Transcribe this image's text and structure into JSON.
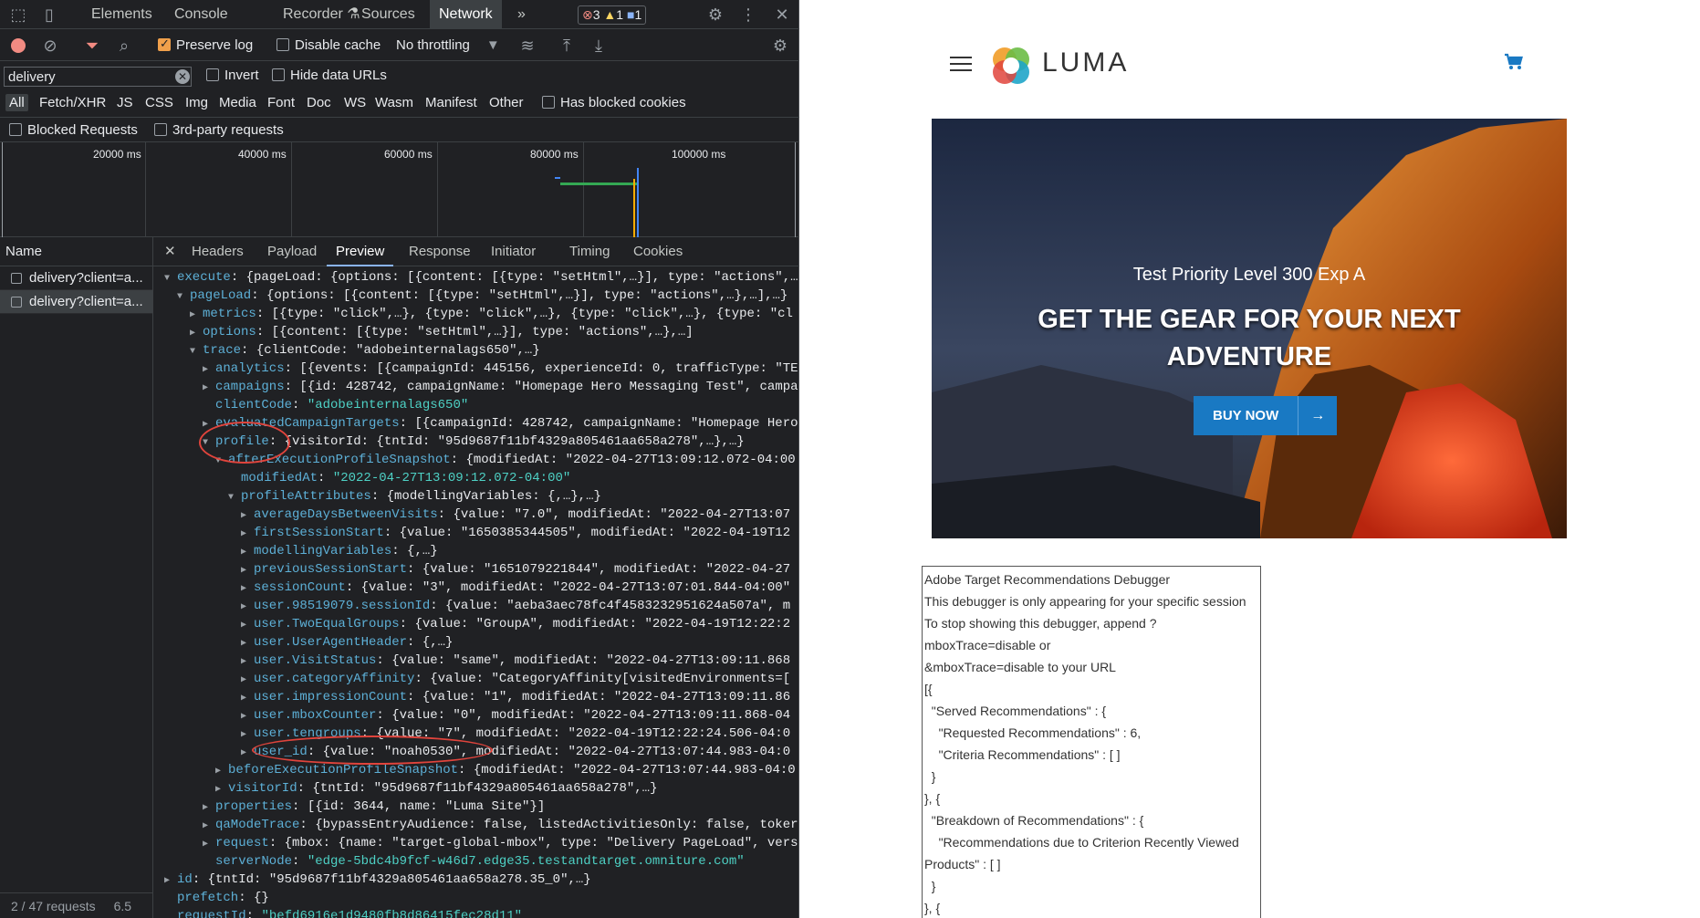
{
  "devtools": {
    "tabs": [
      "Elements",
      "Console",
      "Recorder",
      "Sources",
      "Network"
    ],
    "active_tab": "Network",
    "more": "»",
    "badges": {
      "errors": "3",
      "warnings": "1",
      "issues": "1"
    },
    "toolbar": {
      "preserve_log": "Preserve log",
      "disable_cache": "Disable cache",
      "throttling": "No throttling"
    },
    "filter": {
      "value": "delivery",
      "invert": "Invert",
      "hide_data_urls": "Hide data URLs"
    },
    "types": [
      "All",
      "Fetch/XHR",
      "JS",
      "CSS",
      "Img",
      "Media",
      "Font",
      "Doc",
      "WS",
      "Wasm",
      "Manifest",
      "Other"
    ],
    "has_blocked_cookies": "Has blocked cookies",
    "blocked_requests": "Blocked Requests",
    "third_party": "3rd-party requests",
    "timeline_ticks": [
      "20000 ms",
      "40000 ms",
      "60000 ms",
      "80000 ms",
      "100000 ms"
    ],
    "name_header": "Name",
    "requests": [
      "delivery?client=a...",
      "delivery?client=a..."
    ],
    "status": "2 / 47 requests",
    "status_size": "6.5",
    "detail_tabs": [
      "Headers",
      "Payload",
      "Preview",
      "Response",
      "Initiator",
      "Timing",
      "Cookies"
    ],
    "active_detail_tab": "Preview",
    "preview_lines": [
      {
        "indent": 1,
        "tri": "▼",
        "key": "execute",
        "rest": ": {pageLoad: {options: [{content: [{type: \"setHtml\",…}], type: \"actions\",…"
      },
      {
        "indent": 2,
        "tri": "▼",
        "key": "pageLoad",
        "rest": ": {options: [{content: [{type: \"setHtml\",…}], type: \"actions\",…},…],…}"
      },
      {
        "indent": 3,
        "tri": "▶",
        "key": "metrics",
        "rest": ": [{type: \"click\",…}, {type: \"click\",…}, {type: \"click\",…}, {type: \"cl"
      },
      {
        "indent": 3,
        "tri": "▶",
        "key": "options",
        "rest": ": [{content: [{type: \"setHtml\",…}], type: \"actions\",…},…]"
      },
      {
        "indent": 3,
        "tri": "▼",
        "key": "trace",
        "rest": ": {clientCode: \"adobeinternalags650\",…}"
      },
      {
        "indent": 4,
        "tri": "▶",
        "key": "analytics",
        "rest": ": [{events: [{campaignId: 445156, experienceId: 0, trafficType: \"TE"
      },
      {
        "indent": 4,
        "tri": "▶",
        "key": "campaigns",
        "rest": ": [{id: 428742, campaignName: \"Homepage Hero Messaging Test\", campa"
      },
      {
        "indent": 4,
        "tri": "",
        "key": "clientCode",
        "rest": ": ",
        "str": "\"adobeinternalags650\""
      },
      {
        "indent": 4,
        "tri": "▶",
        "key": "evaluatedCampaignTargets",
        "rest": ": [{campaignId: 428742, campaignName: \"Homepage Hero"
      },
      {
        "indent": 4,
        "tri": "▼",
        "key": "profile",
        "rest": ": {visitorId: {tntId: \"95d9687f11bf4329a805461aa658a278\",…},…}"
      },
      {
        "indent": 5,
        "tri": "▼",
        "key": "afterExecutionProfileSnapshot",
        "rest": ": {modifiedAt: \"2022-04-27T13:09:12.072-04:00"
      },
      {
        "indent": 6,
        "tri": "",
        "key": "modifiedAt",
        "rest": ": ",
        "str": "\"2022-04-27T13:09:12.072-04:00\""
      },
      {
        "indent": 6,
        "tri": "▼",
        "key": "profileAttributes",
        "rest": ": {modellingVariables: {,…},…}"
      },
      {
        "indent": 7,
        "tri": "▶",
        "key": "averageDaysBetweenVisits",
        "rest": ": {value: \"7.0\", modifiedAt: \"2022-04-27T13:07"
      },
      {
        "indent": 7,
        "tri": "▶",
        "key": "firstSessionStart",
        "rest": ": {value: \"1650385344505\", modifiedAt: \"2022-04-19T12"
      },
      {
        "indent": 7,
        "tri": "▶",
        "key": "modellingVariables",
        "rest": ": {,…}"
      },
      {
        "indent": 7,
        "tri": "▶",
        "key": "previousSessionStart",
        "rest": ": {value: \"1651079221844\", modifiedAt: \"2022-04-27"
      },
      {
        "indent": 7,
        "tri": "▶",
        "key": "sessionCount",
        "rest": ": {value: \"3\", modifiedAt: \"2022-04-27T13:07:01.844-04:00\""
      },
      {
        "indent": 7,
        "tri": "▶",
        "key": "user.98519079.sessionId",
        "rest": ": {value: \"aeba3aec78fc4f4583232951624a507a\", m"
      },
      {
        "indent": 7,
        "tri": "▶",
        "key": "user.TwoEqualGroups",
        "rest": ": {value: \"GroupA\", modifiedAt: \"2022-04-19T12:22:2"
      },
      {
        "indent": 7,
        "tri": "▶",
        "key": "user.UserAgentHeader",
        "rest": ": {,…}"
      },
      {
        "indent": 7,
        "tri": "▶",
        "key": "user.VisitStatus",
        "rest": ": {value: \"same\", modifiedAt: \"2022-04-27T13:09:11.868"
      },
      {
        "indent": 7,
        "tri": "▶",
        "key": "user.categoryAffinity",
        "rest": ": {value: \"CategoryAffinity[visitedEnvironments=["
      },
      {
        "indent": 7,
        "tri": "▶",
        "key": "user.impressionCount",
        "rest": ": {value: \"1\", modifiedAt: \"2022-04-27T13:09:11.86"
      },
      {
        "indent": 7,
        "tri": "▶",
        "key": "user.mboxCounter",
        "rest": ": {value: \"0\", modifiedAt: \"2022-04-27T13:09:11.868-04"
      },
      {
        "indent": 7,
        "tri": "▶",
        "key": "user.tengroups",
        "rest": ": {value: \"7\", modifiedAt: \"2022-04-19T12:22:24.506-04:0"
      },
      {
        "indent": 7,
        "tri": "▶",
        "key": "user_id",
        "rest": ": {value: \"noah0530\", modifiedAt: \"2022-04-27T13:07:44.983-04:0"
      },
      {
        "indent": 5,
        "tri": "▶",
        "key": "beforeExecutionProfileSnapshot",
        "rest": ": {modifiedAt: \"2022-04-27T13:07:44.983-04:0"
      },
      {
        "indent": 5,
        "tri": "▶",
        "key": "visitorId",
        "rest": ": {tntId: \"95d9687f11bf4329a805461aa658a278\",…}"
      },
      {
        "indent": 4,
        "tri": "▶",
        "key": "properties",
        "rest": ": [{id: 3644, name: \"Luma Site\"}]"
      },
      {
        "indent": 4,
        "tri": "▶",
        "key": "qaModeTrace",
        "rest": ": {bypassEntryAudience: false, listedActivitiesOnly: false, toker"
      },
      {
        "indent": 4,
        "tri": "▶",
        "key": "request",
        "rest": ": {mbox: {name: \"target-global-mbox\", type: \"Delivery PageLoad\", vers"
      },
      {
        "indent": 4,
        "tri": "",
        "key": "serverNode",
        "rest": ": ",
        "str": "\"edge-5bdc4b9fcf-w46d7.edge35.testandtarget.omniture.com\""
      },
      {
        "indent": 1,
        "tri": "▶",
        "key": "id",
        "rest": ": {tntId: \"95d9687f11bf4329a805461aa658a278.35_0\",…}"
      },
      {
        "indent": 1,
        "tri": "",
        "key": "prefetch",
        "rest": ": {}"
      },
      {
        "indent": 1,
        "tri": "",
        "key": "requestId",
        "rest": ": ",
        "str": "\"befd6916e1d9480fb8d86415fec28d11\""
      }
    ]
  },
  "page": {
    "logo": "LUMA",
    "hero": {
      "subtitle": "Test Priority Level 300 Exp A",
      "title": "GET THE GEAR FOR YOUR NEXT ADVENTURE",
      "button": "BUY NOW",
      "button_arrow": "→"
    },
    "debugger_lines": [
      "Adobe Target Recommendations Debugger",
      "This debugger is only appearing for your specific session",
      "To stop showing this debugger, append ?",
      "mboxTrace=disable or",
      "&mboxTrace=disable to your URL",
      "[{",
      "  \"Served Recommendations\" : {",
      "    \"Requested Recommendations\" : 6,",
      "    \"Criteria Recommendations\" : [ ]",
      "  }",
      "}, {",
      "  \"Breakdown of Recommendations\" : {",
      "    \"Recommendations due to Criterion Recently Viewed",
      "Products\" : [ ]",
      "  }",
      "}, {"
    ],
    "colors": {
      "button": "#1979c3",
      "annotation": "#e0443c"
    }
  }
}
